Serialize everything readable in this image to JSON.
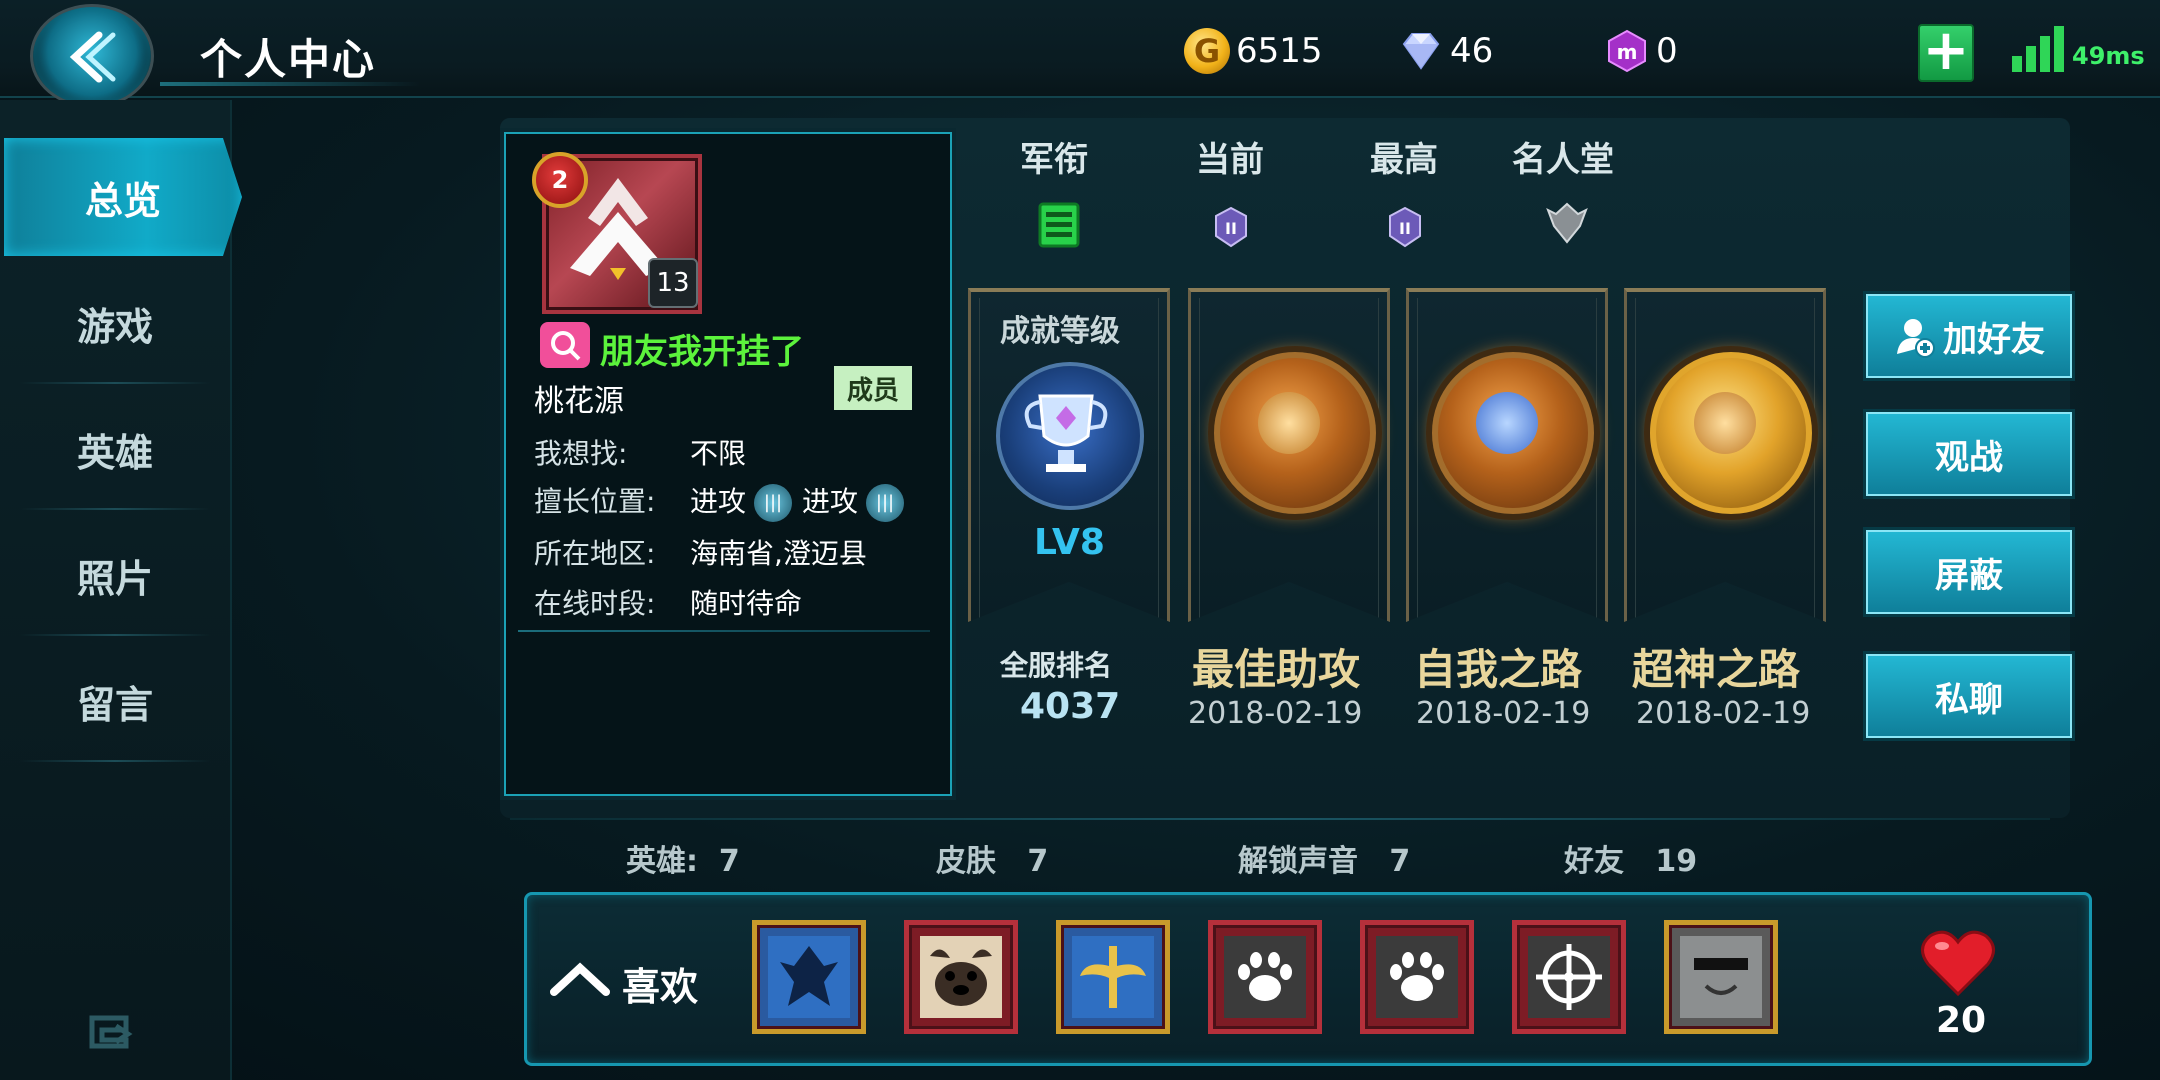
{
  "header": {
    "title": "个人中心",
    "gold": "6515",
    "diamonds": "46",
    "gems": "0",
    "ping": "49ms"
  },
  "sidebar": {
    "items": [
      {
        "label": "总览",
        "active": true
      },
      {
        "label": "游戏",
        "active": false
      },
      {
        "label": "英雄",
        "active": false
      },
      {
        "label": "照片",
        "active": false
      },
      {
        "label": "留言",
        "active": false
      }
    ]
  },
  "profile": {
    "rank_number": "2",
    "level": "13",
    "nickname": "朋友我开挂了",
    "guild": "桃花源",
    "guild_role": "成员",
    "seeking_label": "我想找:",
    "seeking_value": "不限",
    "position_label": "擅长位置:",
    "position_1": "进攻",
    "position_2": "进攻",
    "region_label": "所在地区:",
    "region_value": "海南省,澄迈县",
    "online_label": "在线时段:",
    "online_value": "随时待命"
  },
  "ranks": {
    "headers": [
      "军衔",
      "当前",
      "最高",
      "名人堂"
    ]
  },
  "achievement": {
    "label": "成就等级",
    "level": "LV8",
    "rank_label": "全服排名",
    "rank_value": "4037"
  },
  "medals": [
    {
      "name": "最佳助攻",
      "date": "2018-02-19"
    },
    {
      "name": "自我之路",
      "date": "2018-02-19"
    },
    {
      "name": "超神之路",
      "date": "2018-02-19"
    }
  ],
  "actions": {
    "add_friend": "加好友",
    "spectate": "观战",
    "block": "屏蔽",
    "private_chat": "私聊"
  },
  "stats": {
    "heroes_label": "英雄:",
    "heroes_value": "7",
    "skins_label": "皮肤",
    "skins_value": "7",
    "voices_label": "解锁声音",
    "voices_value": "7",
    "friends_label": "好友",
    "friends_value": "19"
  },
  "likes": {
    "label": "喜欢",
    "count": "20",
    "avatars": [
      "skyrim-emblem",
      "pug",
      "sword-emblem",
      "paw",
      "paw",
      "crosshair",
      "cat-sunglasses"
    ]
  },
  "colors": {
    "accent": "#1ba2b6",
    "nickname": "#5cf33c",
    "achievement_text": "#e8d69c",
    "level_text": "#34c3f0"
  }
}
